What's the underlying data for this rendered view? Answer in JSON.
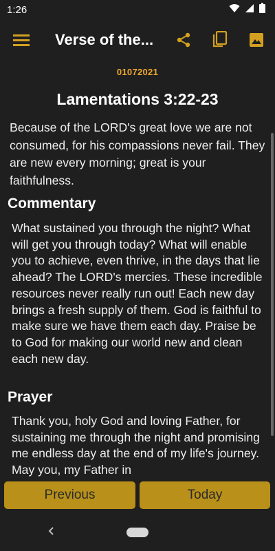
{
  "status_bar": {
    "time": "1:26"
  },
  "app_bar": {
    "title": "Verse of the...",
    "menu_icon": "hamburger-menu-icon",
    "actions": [
      "share-icon",
      "copy-icon",
      "image-icon"
    ]
  },
  "content": {
    "date": "01072021",
    "reference": "Lamentations 3:22-23",
    "verse": "Because of the LORD's great love we are not consumed, for his compassions never fail. They are new every morning; great is your faithfulness.",
    "commentary_heading": "Commentary",
    "commentary": "What sustained you through the night? What will get you through today? What will enable you to achieve, even thrive, in the days that lie ahead? The LORD's mercies. These incredible resources never really run out! Each new day brings a fresh supply of them. God is faithful to make sure we have them each day. Praise be to God for making our world new and clean each new day.",
    "prayer_heading": "Prayer",
    "prayer": "Thank you, holy God and loving Father, for sustaining me through the night and promising me endless day at the end of my life's journey. May you, my Father in"
  },
  "buttons": {
    "previous": "Previous",
    "today": "Today"
  },
  "colors": {
    "accent": "#f0a830",
    "button": "#b8901a",
    "background": "#1f1f1f"
  }
}
